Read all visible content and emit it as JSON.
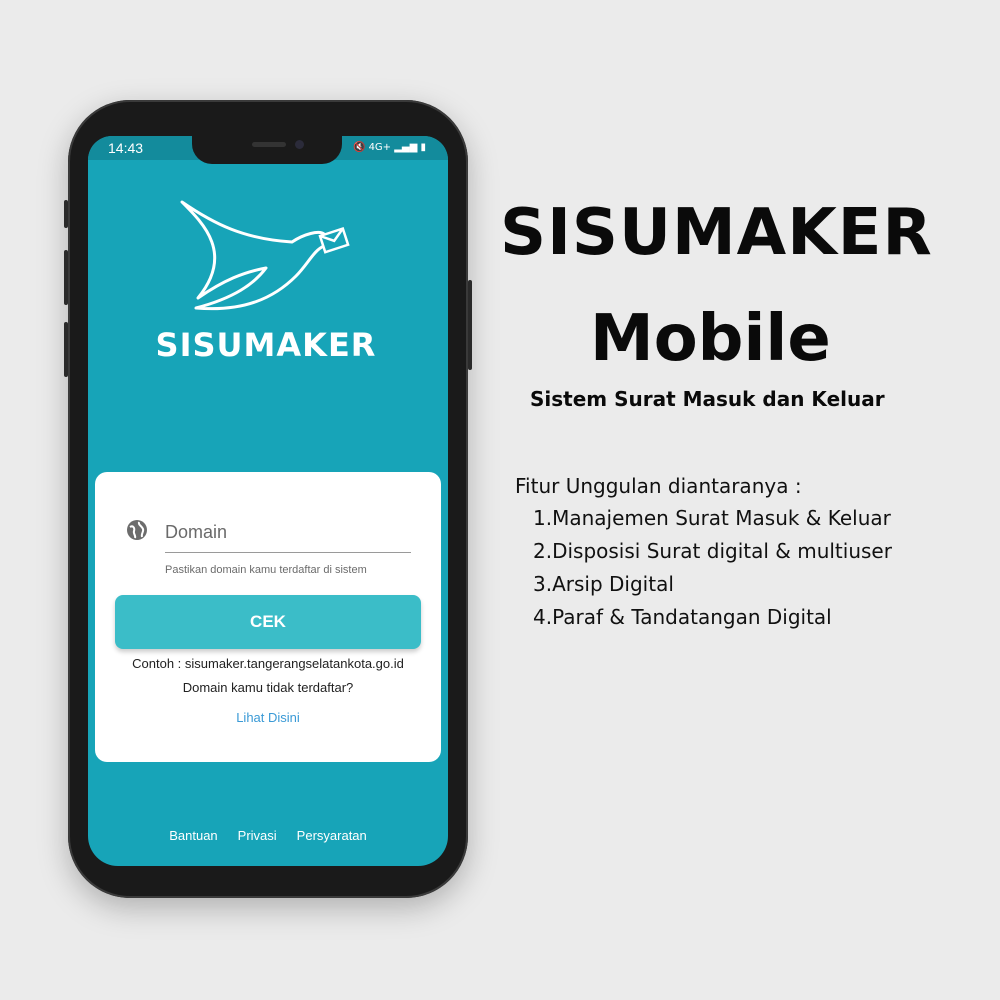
{
  "status_bar": {
    "time": "14:43",
    "icons": "🔇 4G+ ▂▄▆ ▮"
  },
  "app": {
    "name": "SISUMAKER",
    "logo_icon": "bird-with-envelope-icon",
    "background_color": "#17a4b8"
  },
  "login_card": {
    "domain_placeholder": "Domain",
    "domain_value": "",
    "hint": "Pastikan domain kamu terdaftar di sistem",
    "check_button_label": "CEK",
    "example": "Contoh : sisumaker.tangerangselatankota.go.id",
    "not_registered": "Domain kamu tidak terdaftar?",
    "see_here_link": "Lihat Disini",
    "button_color": "#3bbdc8",
    "link_color": "#3a9ad6"
  },
  "footer": {
    "links": [
      "Bantuan",
      "Privasi",
      "Persyaratan"
    ]
  },
  "promo": {
    "title_line1": "SISUMAKER",
    "title_line2": "Mobile",
    "subtitle": "Sistem Surat Masuk dan Keluar",
    "features_heading": "Fitur Unggulan diantaranya :",
    "features": [
      "1.Manajemen Surat Masuk & Keluar",
      "2.Disposisi Surat digital & multiuser",
      "3.Arsip Digital",
      "4.Paraf & Tandatangan Digital"
    ]
  }
}
